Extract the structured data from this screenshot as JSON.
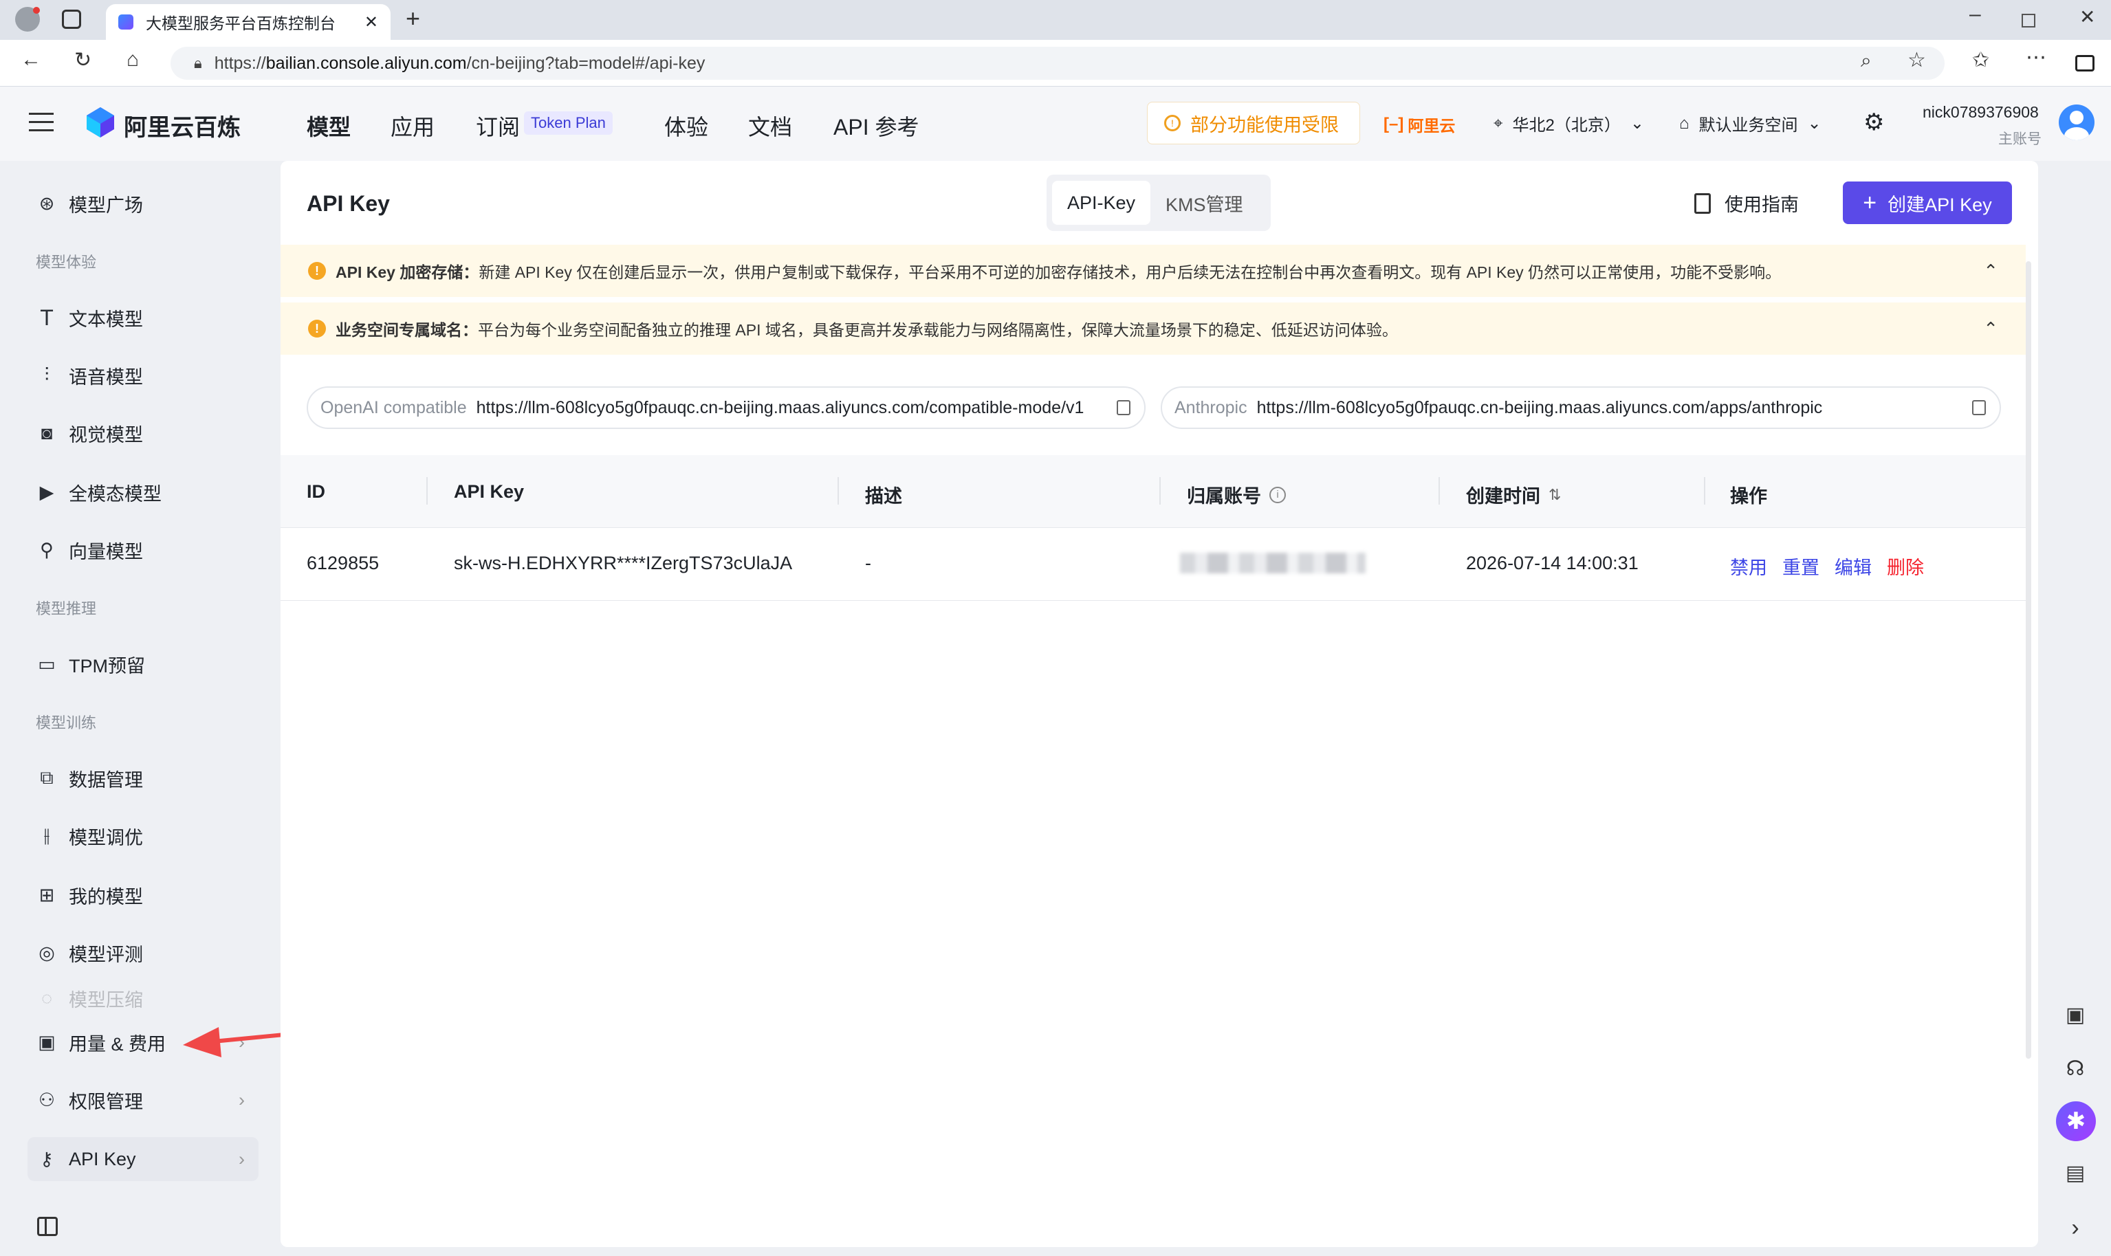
{
  "browser": {
    "tab_title": "大模型服务平台百炼控制台",
    "url_prefix": "https://",
    "url_host": "bailian.console.aliyun.com",
    "url_path": "/cn-beijing?tab=model#/api-key"
  },
  "header": {
    "brand": "阿里云百炼",
    "nav": [
      "模型",
      "应用",
      "订阅",
      "体验",
      "文档",
      "API 参考"
    ],
    "subscribe_badge": "Token Plan",
    "restricted_notice": "部分功能使用受限",
    "aliyun_logo_text": "阿里云",
    "region": "华北2（北京）",
    "workspace": "默认业务空间",
    "username": "nick0789376908",
    "account_type": "主账号"
  },
  "sidebar": {
    "top_item": "模型广场",
    "sections": [
      {
        "title": "模型体验",
        "items": [
          "文本模型",
          "语音模型",
          "视觉模型",
          "全模态模型",
          "向量模型"
        ]
      },
      {
        "title": "模型推理",
        "items": [
          "TPM预留"
        ]
      },
      {
        "title": "模型训练",
        "items": [
          "数据管理",
          "模型调优",
          "我的模型",
          "模型评测",
          "模型压缩"
        ]
      }
    ],
    "bottom_items": [
      "用量 & 费用",
      "权限管理",
      "API Key"
    ]
  },
  "page": {
    "title": "API Key",
    "toggle": [
      "API-Key",
      "KMS管理"
    ],
    "guide_label": "使用指南",
    "create_label": "创建API Key",
    "notices": [
      {
        "bold": "API Key 加密存储：",
        "text": "新建 API Key 仅在创建后显示一次，供用户复制或下载保存，平台采用不可逆的加密存储技术，用户后续无法在控制台中再次查看明文。现有 API Key 仍然可以正常使用，功能不受影响。"
      },
      {
        "bold": "业务空间专属域名：",
        "text": "平台为每个业务空间配备独立的推理 API 域名，具备更高并发承载能力与网络隔离性，保障大流量场景下的稳定、低延迟访问体验。"
      }
    ],
    "endpoints": [
      {
        "label": "OpenAI compatible",
        "url": "https://llm-608lcyo5g0fpauqc.cn-beijing.maas.aliyuncs.com/compatible-mode/v1"
      },
      {
        "label": "Anthropic",
        "url": "https://llm-608lcyo5g0fpauqc.cn-beijing.maas.aliyuncs.com/apps/anthropic"
      }
    ],
    "table": {
      "headers": [
        "ID",
        "API Key",
        "描述",
        "归属账号",
        "创建时间",
        "操作"
      ],
      "rows": [
        {
          "id": "6129855",
          "key": "sk-ws-H.EDHXYRR****IZergTS73cUlaJA",
          "desc": "-",
          "created": "2026-07-14 14:00:31"
        }
      ],
      "actions": [
        "禁用",
        "重置",
        "编辑",
        "删除"
      ]
    }
  },
  "colors": {
    "accent": "#4f46e5",
    "link": "#3d46e6",
    "danger": "#f5222d",
    "warning": "#f5a623",
    "annotation_arrow": "#f04848"
  }
}
